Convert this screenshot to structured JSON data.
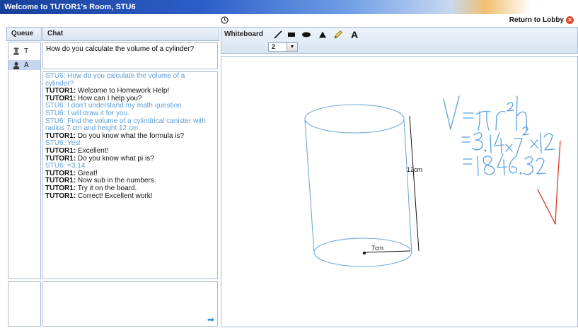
{
  "window": {
    "title": "Welcome to TUTOR1's Room, STU6"
  },
  "header": {
    "return_label": "Return to Lobby"
  },
  "queue": {
    "label": "Queue",
    "items": [
      {
        "name": "T"
      },
      {
        "name": "A"
      }
    ]
  },
  "chat": {
    "label": "Chat",
    "input_value": "How do you calculate the volume of a cylinder?",
    "messages": [
      {
        "sender": "STU6:",
        "text": " How do you calculate the volume of a cylinder?",
        "role": "student"
      },
      {
        "sender": "TUTOR1:",
        "text": " Welcome to Homework Help!",
        "role": "tutor"
      },
      {
        "sender": "TUTOR1:",
        "text": " How can I help you?",
        "role": "tutor"
      },
      {
        "sender": "STU6:",
        "text": " I don't understand my math question.",
        "role": "student"
      },
      {
        "sender": "STU6:",
        "text": " I will draw it for you.",
        "role": "student"
      },
      {
        "sender": "STU6:",
        "text": " Find the volume of a cylindrical canister with radius 7 cm and height 12 cm.",
        "role": "student"
      },
      {
        "sender": "TUTOR1:",
        "text": " Do you know what the formula is?",
        "role": "tutor"
      },
      {
        "sender": "STU6:",
        "text": " Yes!",
        "role": "student"
      },
      {
        "sender": "TUTOR1:",
        "text": " Excellent!",
        "role": "tutor"
      },
      {
        "sender": "TUTOR1:",
        "text": " Do you know what pi is?",
        "role": "tutor"
      },
      {
        "sender": "STU6:",
        "text": " =3.14",
        "role": "student"
      },
      {
        "sender": "TUTOR1:",
        "text": " Great!",
        "role": "tutor"
      },
      {
        "sender": "TUTOR1:",
        "text": " Now sub in the numbers.",
        "role": "tutor"
      },
      {
        "sender": "TUTOR1:",
        "text": " Try it on the board.",
        "role": "tutor"
      },
      {
        "sender": "TUTOR1:",
        "text": " Correct!  Excellent work!",
        "role": "tutor"
      }
    ]
  },
  "whiteboard": {
    "label": "Whiteboard",
    "stroke_size": "2",
    "tools": [
      "line-tool-icon",
      "rectangle-tool-icon",
      "ellipse-tool-icon",
      "triangle-tool-icon",
      "pencil-tool-icon",
      "text-tool-icon"
    ],
    "text_tool_glyph": "A",
    "height_label": "12cm",
    "radius_label": "7cm",
    "handwriting": {
      "line1": "V = πr²h",
      "line2": "= 3.14×7²×12",
      "line3": "= 1846.32"
    }
  },
  "colors": {
    "student": "#5d9ed6",
    "drawing": "#6fa8dc",
    "check": "#d9382b",
    "title_bar": "#2d5ec8"
  }
}
